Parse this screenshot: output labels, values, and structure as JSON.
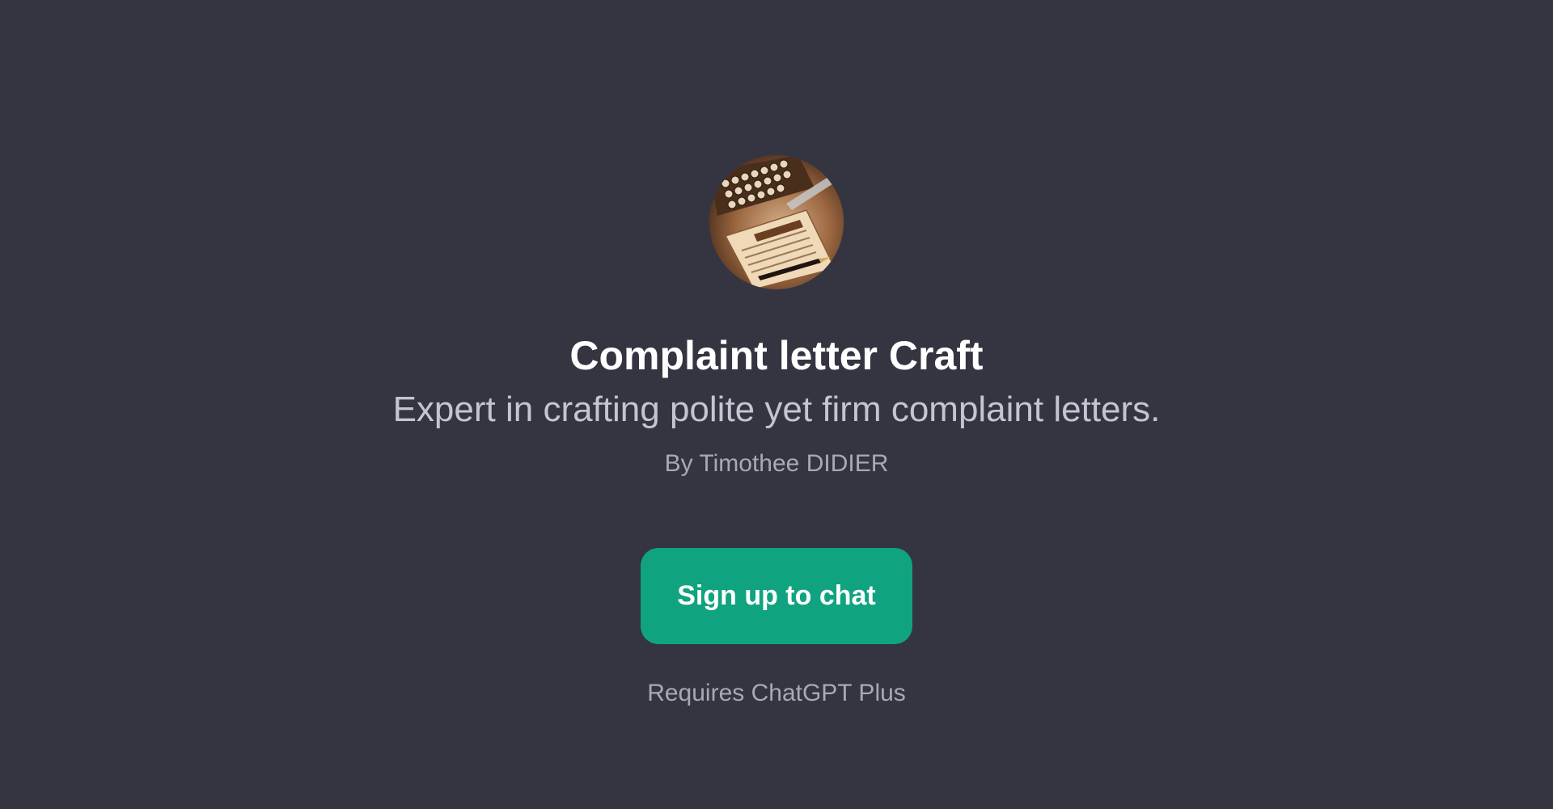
{
  "gpt": {
    "avatar_icon": "typewriter-letter-image",
    "title": "Complaint letter Craft",
    "description": "Expert in crafting polite yet firm complaint letters.",
    "author": "By Timothee DIDIER"
  },
  "cta": {
    "signup_label": "Sign up to chat",
    "requirement": "Requires ChatGPT Plus"
  },
  "colors": {
    "background": "#343541",
    "button": "#10a37f",
    "title": "#ffffff",
    "subtitle": "#c5c5d2",
    "muted": "#a9a9b3"
  }
}
